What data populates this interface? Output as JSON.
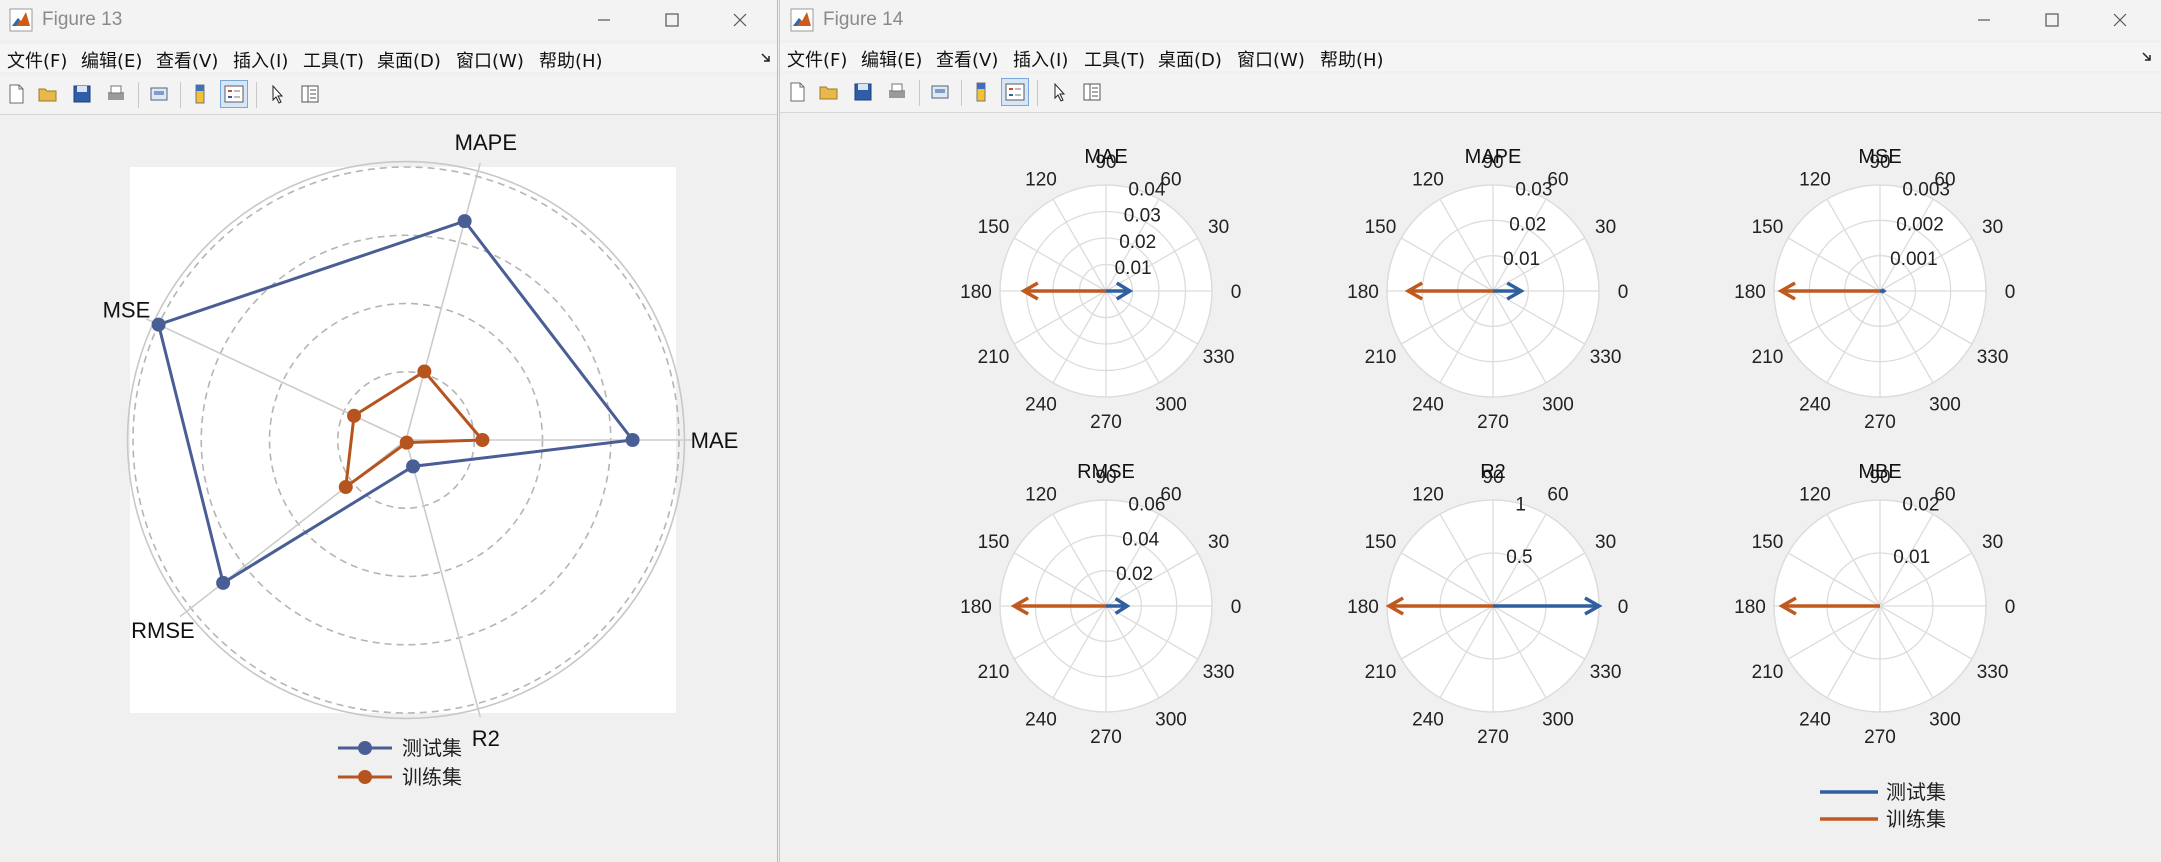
{
  "windows": [
    {
      "id": "win13",
      "title": "Figure 13",
      "menu": [
        "文件(F)",
        "编辑(E)",
        "查看(V)",
        "插入(I)",
        "工具(T)",
        "桌面(D)",
        "窗口(W)",
        "帮助(H)"
      ]
    },
    {
      "id": "win14",
      "title": "Figure 14",
      "menu": [
        "文件(F)",
        "编辑(E)",
        "查看(V)",
        "插入(I)",
        "工具(T)",
        "桌面(D)",
        "窗口(W)",
        "帮助(H)"
      ]
    }
  ],
  "toolbar_icons": [
    "new-figure-icon",
    "open-file-icon",
    "save-icon",
    "print-icon",
    "link-plot-icon",
    "colorbar-icon",
    "legend-icon",
    "edit-plot-icon",
    "property-inspector-icon"
  ],
  "colors": {
    "test": "#4a5e96",
    "train": "#b6541f",
    "test_polar": "#2f5f9f",
    "train_polar": "#bf5a1f"
  },
  "chart_data": [
    {
      "type": "radar",
      "categories": [
        "MAE",
        "MAPE",
        "MSE",
        "RMSE",
        "R2"
      ],
      "axis_angles_deg": [
        0,
        75,
        155,
        218,
        285
      ],
      "rlim": [
        0,
        1
      ],
      "grid": "dashed",
      "legend": "bottom",
      "series": [
        {
          "name": "测试集",
          "values": [
            0.83,
            0.83,
            1.0,
            0.85,
            0.1
          ]
        },
        {
          "name": "训练集",
          "values": [
            0.28,
            0.26,
            0.21,
            0.28,
            0.01
          ]
        }
      ]
    },
    {
      "type": "compass",
      "layout": "2x3",
      "angle_ticks": [
        "0",
        "30",
        "60",
        "90",
        "120",
        "150",
        "180",
        "210",
        "240",
        "270",
        "300",
        "330"
      ],
      "legend": "bottom-right",
      "series_names": [
        "测试集",
        "训练集"
      ],
      "subplots": [
        {
          "title": "MAE",
          "r_ticks": [
            "0.01",
            "0.02",
            "0.03",
            "0.04"
          ],
          "rmax": 0.04,
          "test": 0.009,
          "train": -0.031
        },
        {
          "title": "MAPE",
          "r_ticks": [
            "0.01",
            "0.02",
            "0.03"
          ],
          "rmax": 0.03,
          "test": 0.008,
          "train": -0.024
        },
        {
          "title": "MSE",
          "r_ticks": [
            "0.001",
            "0.002",
            "0.003"
          ],
          "rmax": 0.003,
          "test": 0.0001,
          "train": -0.0028
        },
        {
          "title": "RMSE",
          "r_ticks": [
            "0.02",
            "0.04",
            "0.06"
          ],
          "rmax": 0.06,
          "test": 0.012,
          "train": -0.052
        },
        {
          "title": "R2",
          "r_ticks": [
            "0.5",
            "1"
          ],
          "rmax": 1,
          "test": 1.0,
          "train": -0.98
        },
        {
          "title": "MBE",
          "r_ticks": [
            "0.01",
            "0.02"
          ],
          "rmax": 0.02,
          "test": 0.0,
          "train": -0.0185
        }
      ]
    }
  ]
}
